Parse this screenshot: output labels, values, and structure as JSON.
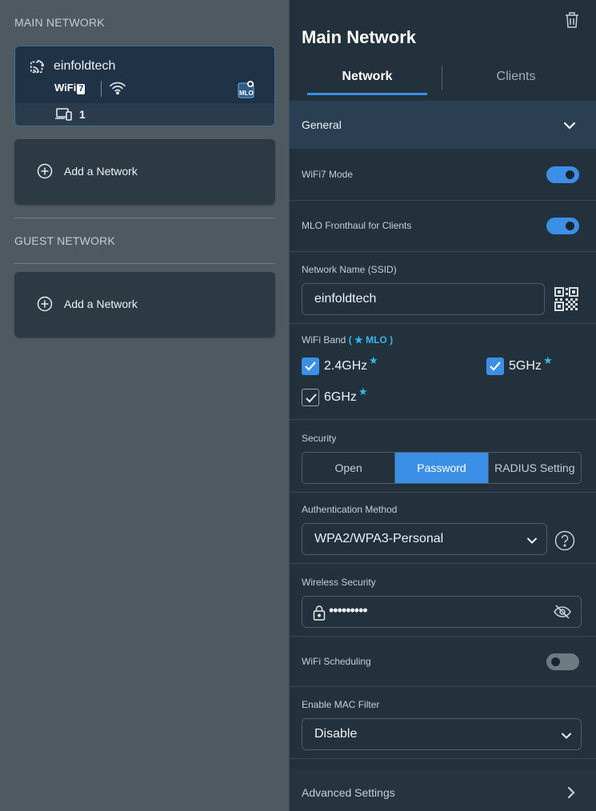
{
  "left": {
    "main_section_title": "MAIN NETWORK",
    "guest_section_title": "GUEST NETWORK",
    "main_network": {
      "name": "einfoldtech",
      "wifi_badge": "WiFi",
      "wifi_badge_num": "7",
      "mlo_badge": "MLO",
      "client_count": "1"
    },
    "add_main_label": "Add a Network",
    "add_guest_label": "Add a Network"
  },
  "panel": {
    "title": "Main Network",
    "tabs": [
      {
        "label": "Network",
        "active": true
      },
      {
        "label": "Clients",
        "active": false
      }
    ],
    "general_label": "General",
    "wifi7_mode_label": "WiFi7 Mode",
    "wifi7_mode_on": true,
    "mlo_fronthaul_label": "MLO Fronthaul for Clients",
    "mlo_fronthaul_on": true,
    "ssid_label": "Network Name (SSID)",
    "ssid_value": "einfoldtech",
    "band_label": "WiFi Band",
    "band_mlo_note": "( ★ MLO )",
    "bands": [
      {
        "label": "2.4GHz",
        "checked": true,
        "star": "★"
      },
      {
        "label": "5GHz",
        "checked": true,
        "star": "★"
      },
      {
        "label": "6GHz",
        "checked": true,
        "star": "★"
      }
    ],
    "security_label": "Security",
    "security_options": [
      "Open",
      "Password",
      "RADIUS Setting"
    ],
    "security_selected": "Password",
    "auth_label": "Authentication Method",
    "auth_value": "WPA2/WPA3-Personal",
    "wireless_security_label": "Wireless Security",
    "password_mask": "•••••••••",
    "scheduling_label": "WiFi Scheduling",
    "scheduling_on": false,
    "mac_filter_label": "Enable MAC Filter",
    "mac_filter_value": "Disable",
    "advanced_label": "Advanced Settings"
  },
  "colors": {
    "accent": "#3b8fe6",
    "mlo_accent": "#33b8ee",
    "panel_bg": "#22313b",
    "page_bg": "#4f5a60"
  }
}
